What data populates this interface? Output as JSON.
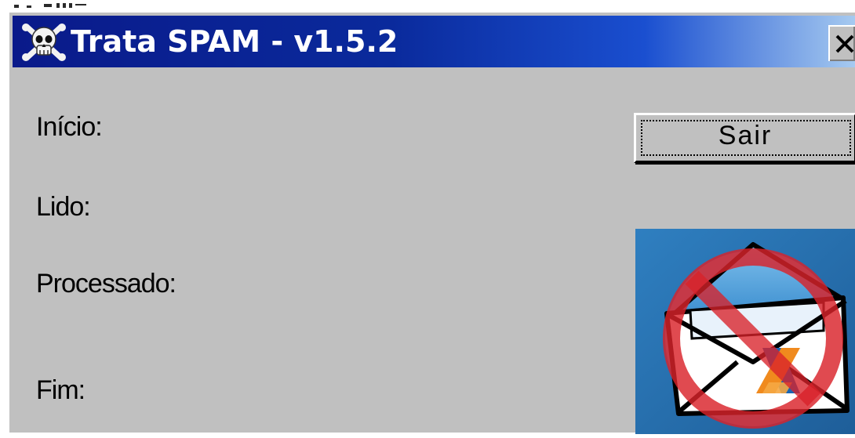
{
  "window": {
    "title": "Trata SPAM - v1.5.2",
    "title_icon": "skull-crossbones-icon",
    "close_icon": "close-x-icon"
  },
  "fields": {
    "inicio_label": "Início:",
    "lido_label": "Lido:",
    "processado_label": "Processado:",
    "fim_label": "Fim:"
  },
  "buttons": {
    "sair_label": "Sair"
  },
  "logo": {
    "icon": "no-spam-envelope-icon"
  },
  "colors": {
    "titlebar_start": "#0a1a8a",
    "titlebar_end": "#a6caf0",
    "window_bg": "#c0c0c0",
    "prohibition_red": "#d9222a"
  }
}
